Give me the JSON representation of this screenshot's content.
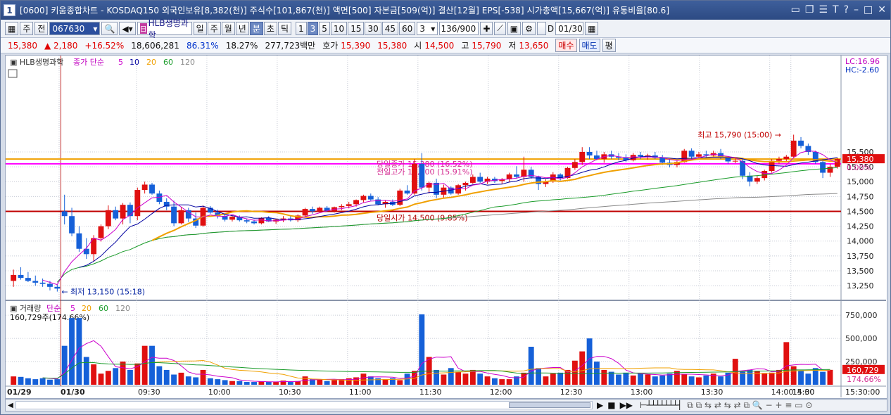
{
  "window": {
    "number": "1",
    "title": "[0600] 키움종합차트 - KOSDAQ150 외국인보유[8,382(천)] 주식수[101,867(천)] 액면[500] 자본금[509(억)] 결산[12월] EPS[-538] 시가총액[15,667(억)] 유통비율[80.6]",
    "icons": [
      "minimize-tray-icon",
      "restore-icon",
      "list-icon",
      "font-icon",
      "help-icon",
      "minimize-icon",
      "maximize-icon",
      "close-icon"
    ]
  },
  "toolbar": {
    "tab_week": "주",
    "tab_all": "전",
    "code": "067630",
    "stock_name": "HLB생명과학",
    "periods": [
      "일",
      "주",
      "월",
      "년",
      "분",
      "초",
      "틱"
    ],
    "active_period": "분",
    "intervals": [
      "1",
      "3",
      "5",
      "10",
      "15",
      "30",
      "45",
      "60"
    ],
    "active_interval": "3",
    "interval_value": "3",
    "count": "136",
    "count_total": "/900",
    "date_checkbox_label": "D",
    "date": "01/30"
  },
  "quote": {
    "price": "15,380",
    "change": "▲ 2,180",
    "change_pct": "+16.52%",
    "volume": "18,606,281",
    "ratio1": "86.31%",
    "ratio2": "18.27%",
    "amount": "277,723백만",
    "bid_label": "호가",
    "ask": "15,390",
    "bid": "15,380",
    "open_label": "시",
    "open": "14,500",
    "high_label": "고",
    "high": "15,790",
    "low_label": "저",
    "low": "13,650",
    "buy": "매수",
    "sell": "매도",
    "eval": "평"
  },
  "colors": {
    "up": "#e01010",
    "down": "#1560d8",
    "ma5": "#cc00cc",
    "ma10": "#0000a0",
    "ma20": "#f0a000",
    "ma60": "#1a9b2a",
    "ma120": "#888888"
  },
  "chart_data": [
    {
      "type": "candlestick",
      "legend": {
        "name": "HLB생명과학",
        "ma_label": "종가 단순",
        "periods": [
          "5",
          "10",
          "20",
          "60",
          "120"
        ]
      },
      "ylim": [
        13050,
        17050
      ],
      "y_ticks": [
        "15,500",
        "15,250",
        "15,000",
        "14,750",
        "14,500",
        "14,250",
        "14,000",
        "13,750",
        "13,500",
        "13,250"
      ],
      "right_labels": {
        "lc": "LC:16.96",
        "hc": "HC:-2.60",
        "current": "15,380",
        "pct": "0.00%"
      },
      "hlines": [
        {
          "value": 14500,
          "label": "당일시가 14,500 (9.85%)",
          "color": "#c00000"
        },
        {
          "value": 15380,
          "label": "당일종가 15,380 (16.52%)",
          "color": "#f0a000"
        },
        {
          "value": 15300,
          "label": "전일고가 15,300 (15.91%)",
          "color": "#ff00ff"
        }
      ],
      "annotations": {
        "high": "최고 15,790 (15:00)",
        "low": "최저 13,150 (15:18)"
      },
      "candles": [
        [
          13330,
          13520,
          13230,
          13430
        ],
        [
          13430,
          13560,
          13350,
          13380
        ],
        [
          13380,
          13480,
          13310,
          13330
        ],
        [
          13330,
          13420,
          13250,
          13300
        ],
        [
          13300,
          13370,
          13230,
          13280
        ],
        [
          13280,
          13330,
          13170,
          13230
        ],
        [
          13230,
          13280,
          13150,
          13200
        ],
        [
          14500,
          14780,
          14280,
          14420
        ],
        [
          14420,
          14560,
          14080,
          14130
        ],
        [
          14130,
          14250,
          13820,
          13870
        ],
        [
          13870,
          14050,
          13700,
          13780
        ],
        [
          13780,
          14100,
          13650,
          14050
        ],
        [
          14050,
          14280,
          13990,
          14250
        ],
        [
          14250,
          14600,
          14200,
          14520
        ],
        [
          14520,
          14580,
          14350,
          14380
        ],
        [
          14380,
          14640,
          14280,
          14610
        ],
        [
          14610,
          14650,
          14300,
          14420
        ],
        [
          14420,
          14900,
          14350,
          14860
        ],
        [
          14860,
          15000,
          14800,
          14950
        ],
        [
          14950,
          14980,
          14780,
          14800
        ],
        [
          14800,
          14850,
          14620,
          14660
        ],
        [
          14660,
          14720,
          14520,
          14580
        ],
        [
          14580,
          14680,
          14250,
          14300
        ],
        [
          14300,
          14570,
          14280,
          14520
        ],
        [
          14520,
          14560,
          14320,
          14380
        ],
        [
          14380,
          14480,
          14220,
          14260
        ],
        [
          14260,
          14600,
          14240,
          14560
        ],
        [
          14560,
          14590,
          14460,
          14480
        ],
        [
          14480,
          14530,
          14380,
          14420
        ],
        [
          14420,
          14450,
          14330,
          14360
        ],
        [
          14360,
          14420,
          14330,
          14410
        ],
        [
          14410,
          14430,
          14330,
          14350
        ],
        [
          14350,
          14380,
          14300,
          14330
        ],
        [
          14330,
          14360,
          14280,
          14300
        ],
        [
          14300,
          14400,
          14280,
          14390
        ],
        [
          14390,
          14420,
          14320,
          14330
        ],
        [
          14330,
          14380,
          14290,
          14360
        ],
        [
          14360,
          14420,
          14320,
          14380
        ],
        [
          14380,
          14420,
          14330,
          14350
        ],
        [
          14350,
          14450,
          14320,
          14430
        ],
        [
          14430,
          14560,
          14400,
          14540
        ],
        [
          14540,
          14580,
          14460,
          14500
        ],
        [
          14500,
          14580,
          14480,
          14560
        ],
        [
          14560,
          14590,
          14490,
          14510
        ],
        [
          14510,
          14580,
          14480,
          14570
        ],
        [
          14570,
          14620,
          14520,
          14590
        ],
        [
          14590,
          14660,
          14550,
          14620
        ],
        [
          14620,
          14700,
          14580,
          14690
        ],
        [
          14690,
          14780,
          14650,
          14760
        ],
        [
          14760,
          14800,
          14680,
          14700
        ],
        [
          14700,
          14740,
          14600,
          14620
        ],
        [
          14620,
          14680,
          14560,
          14660
        ],
        [
          14660,
          14700,
          14590,
          14610
        ],
        [
          14610,
          14880,
          14590,
          14850
        ],
        [
          14850,
          14940,
          14780,
          14800
        ],
        [
          14800,
          15380,
          14780,
          15300
        ],
        [
          15300,
          15480,
          14850,
          14900
        ],
        [
          14900,
          15000,
          14800,
          14980
        ],
        [
          14980,
          15050,
          14720,
          14780
        ],
        [
          14780,
          14950,
          14720,
          14900
        ],
        [
          14900,
          14920,
          14780,
          14800
        ],
        [
          14800,
          14960,
          14780,
          14940
        ],
        [
          14940,
          15000,
          14850,
          14980
        ],
        [
          14980,
          15120,
          14960,
          15080
        ],
        [
          15080,
          15150,
          14980,
          15000
        ],
        [
          15000,
          15080,
          14960,
          15050
        ],
        [
          15050,
          15080,
          14980,
          15010
        ],
        [
          15010,
          15060,
          14960,
          15040
        ],
        [
          15040,
          15150,
          14990,
          15120
        ],
        [
          15120,
          15260,
          15050,
          15080
        ],
        [
          15080,
          15420,
          15000,
          15200
        ],
        [
          15200,
          15250,
          15050,
          15080
        ],
        [
          15080,
          15100,
          14860,
          14960
        ],
        [
          14960,
          15040,
          14910,
          15000
        ],
        [
          15000,
          15160,
          14980,
          15120
        ],
        [
          15120,
          15140,
          15020,
          15060
        ],
        [
          15060,
          15250,
          15050,
          15230
        ],
        [
          15230,
          15380,
          15200,
          15330
        ],
        [
          15330,
          15580,
          15280,
          15500
        ],
        [
          15500,
          15580,
          15380,
          15440
        ],
        [
          15440,
          15520,
          15360,
          15380
        ],
        [
          15380,
          15500,
          15320,
          15460
        ],
        [
          15460,
          15520,
          15380,
          15420
        ],
        [
          15420,
          15480,
          15360,
          15400
        ],
        [
          15400,
          15460,
          15330,
          15360
        ],
        [
          15360,
          15480,
          15340,
          15450
        ],
        [
          15450,
          15500,
          15380,
          15420
        ],
        [
          15420,
          15470,
          15370,
          15440
        ],
        [
          15440,
          15500,
          15380,
          15400
        ],
        [
          15400,
          15450,
          15280,
          15320
        ],
        [
          15320,
          15380,
          15240,
          15280
        ],
        [
          15280,
          15350,
          15240,
          15330
        ],
        [
          15330,
          15550,
          15320,
          15520
        ],
        [
          15520,
          15560,
          15380,
          15420
        ],
        [
          15420,
          15500,
          15400,
          15460
        ],
        [
          15460,
          15520,
          15400,
          15440
        ],
        [
          15440,
          15520,
          15400,
          15480
        ],
        [
          15480,
          15550,
          15380,
          15400
        ],
        [
          15400,
          15430,
          15300,
          15340
        ],
        [
          15340,
          15400,
          15310,
          15350
        ],
        [
          15350,
          15380,
          15040,
          15100
        ],
        [
          15100,
          15160,
          14920,
          15000
        ],
        [
          15000,
          15100,
          14960,
          15060
        ],
        [
          15060,
          15200,
          15020,
          15180
        ],
        [
          15180,
          15380,
          15150,
          15350
        ],
        [
          15350,
          15420,
          15300,
          15380
        ],
        [
          15380,
          15450,
          15330,
          15420
        ],
        [
          15420,
          15790,
          15400,
          15690
        ],
        [
          15690,
          15750,
          15560,
          15600
        ],
        [
          15600,
          15640,
          15450,
          15500
        ],
        [
          15500,
          15520,
          15300,
          15330
        ],
        [
          15330,
          15380,
          15060,
          15150
        ],
        [
          15150,
          15300,
          15080,
          15250
        ],
        [
          15250,
          15400,
          15220,
          15380
        ]
      ],
      "ma": {
        "ma5": "magenta",
        "ma10": "navy",
        "ma20": "orange",
        "ma60": "green",
        "ma120": "gray"
      }
    },
    {
      "type": "bar",
      "legend": {
        "name": "거래량",
        "ma_label": "단순",
        "periods": [
          "5",
          "20",
          "60",
          "120"
        ]
      },
      "info": "160,729주(174.66%)",
      "y_ticks": [
        "750,000",
        "500,000",
        "250,000"
      ],
      "ylim": [
        0,
        850000
      ],
      "right_labels": {
        "current": "160,729",
        "pct": "174.66%"
      },
      "x_labels": [
        "01/29",
        "01/30",
        "09:30",
        "10:00",
        "10:30",
        "11:00",
        "11:30",
        "12:00",
        "12:30",
        "13:00",
        "13:30",
        "14:00",
        "14:30",
        "15:00",
        "15:30:00"
      ],
      "volumes": [
        90000,
        85000,
        70000,
        60000,
        70000,
        55000,
        60000,
        420000,
        720000,
        720000,
        300000,
        220000,
        120000,
        150000,
        180000,
        250000,
        160000,
        230000,
        420000,
        420000,
        200000,
        160000,
        110000,
        130000,
        90000,
        80000,
        160000,
        70000,
        60000,
        50000,
        40000,
        40000,
        30000,
        30000,
        35000,
        30000,
        30000,
        45000,
        30000,
        40000,
        90000,
        60000,
        60000,
        40000,
        50000,
        60000,
        70000,
        80000,
        120000,
        90000,
        70000,
        60000,
        70000,
        50000,
        120000,
        150000,
        760000,
        300000,
        160000,
        110000,
        180000,
        140000,
        120000,
        160000,
        120000,
        90000,
        70000,
        60000,
        60000,
        90000,
        130000,
        410000,
        180000,
        90000,
        120000,
        130000,
        160000,
        260000,
        360000,
        500000,
        250000,
        160000,
        140000,
        110000,
        130000,
        100000,
        120000,
        110000,
        90000,
        100000,
        120000,
        150000,
        110000,
        90000,
        80000,
        100000,
        120000,
        90000,
        130000,
        280000,
        140000,
        160000,
        150000,
        120000,
        130000,
        160000,
        460000,
        200000,
        150000,
        120000,
        180000,
        140000,
        160729
      ]
    }
  ],
  "scroll": {
    "zoom_label": "",
    "buttons": [
      "play-icon",
      "stop-icon",
      "fast-forward-icon"
    ]
  }
}
